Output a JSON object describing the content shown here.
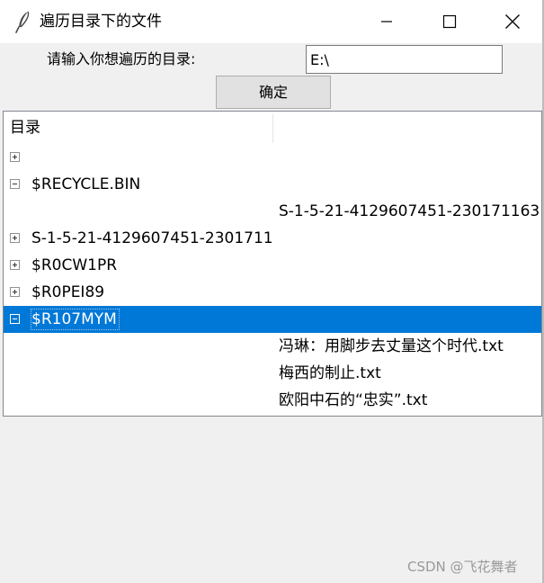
{
  "window": {
    "title": "遍历目录下的文件",
    "icon": "feather-icon"
  },
  "form": {
    "prompt_label": "请输入你想遍历的目录:",
    "directory_value": "E:\\",
    "ok_button_label": "确定"
  },
  "tree": {
    "heading": "目录",
    "rows": [
      {
        "text": "",
        "expander": "plus"
      },
      {
        "text": "$RECYCLE.BIN",
        "expander": "minus"
      },
      {
        "text": "S-1-5-21-4129607451-230171163",
        "expander": "none"
      },
      {
        "text": "S-1-5-21-4129607451-2301711",
        "expander": "plus"
      },
      {
        "text": "$R0CW1PR",
        "expander": "plus"
      },
      {
        "text": "$R0PEI89",
        "expander": "plus"
      },
      {
        "text": "$R107MYM",
        "expander": "minus",
        "selected": true
      },
      {
        "text": "冯琳：用脚步去丈量这个时代.txt",
        "expander": "none"
      },
      {
        "text": "梅西的制止.txt",
        "expander": "none"
      },
      {
        "text": "欧阳中石的“忠实”.txt",
        "expander": "none"
      }
    ]
  },
  "watermark": "CSDN @飞花舞者",
  "colors": {
    "selection": "#0078d7",
    "window_bg": "#f0f0f0",
    "tree_border": "#828790",
    "watermark": "#9a9a9a"
  }
}
